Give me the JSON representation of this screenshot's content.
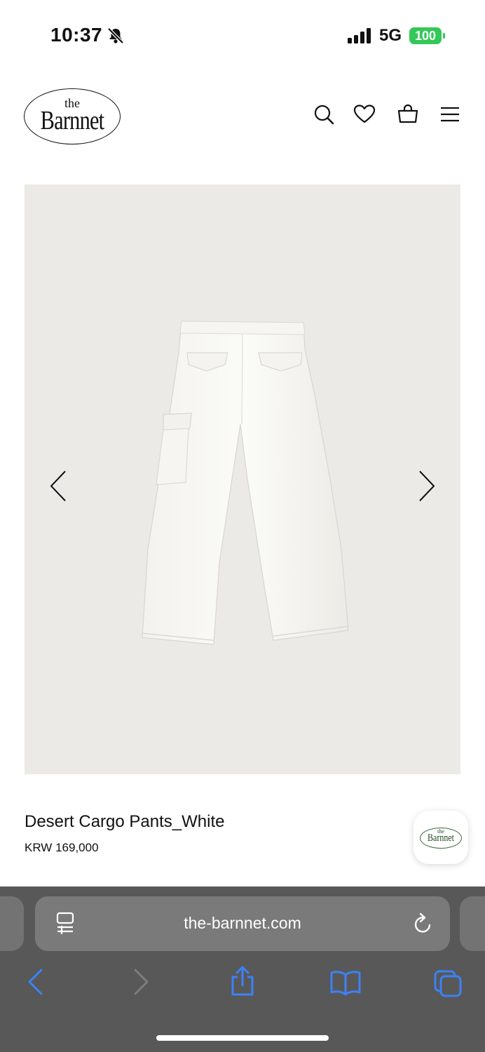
{
  "status_bar": {
    "time": "10:37",
    "network": "5G",
    "battery": "100",
    "battery_color": "#34c759"
  },
  "header": {
    "logo_small": "the",
    "logo_large": "Barnnet",
    "icons": [
      "search-icon",
      "heart-icon",
      "bag-icon",
      "menu-icon"
    ]
  },
  "product": {
    "name": "Desert Cargo Pants_White",
    "price": "KRW 169,000",
    "image_background": "#eceae6"
  },
  "chat": {
    "logo_small": "the",
    "logo_large": "Barnnet"
  },
  "browser": {
    "url": "the-barnnet.com",
    "accent_color": "#3b82f6"
  }
}
